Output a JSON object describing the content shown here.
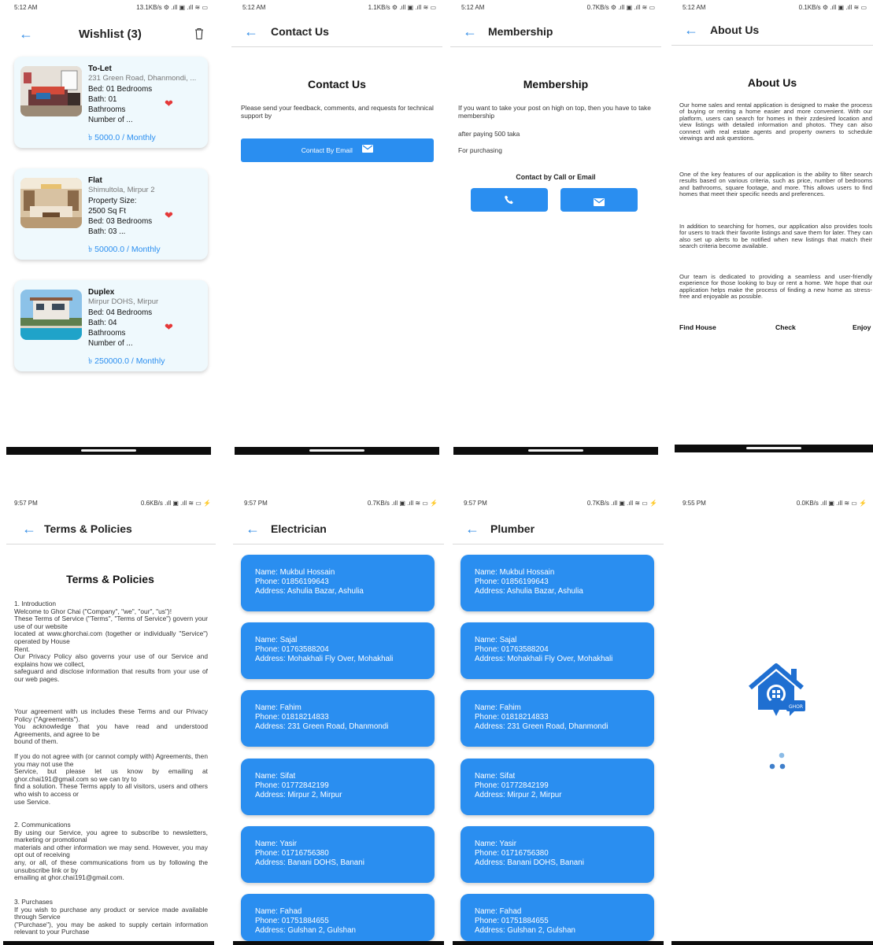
{
  "status_top": {
    "wishlist": {
      "time": "5:12 AM",
      "right": "13.1KB/s ⚙ .ıll ▣ .ıll ≋ ▭"
    },
    "contact": {
      "time": "5:12 AM",
      "right": "1.1KB/s ⚙ .ıll ▣ .ıll ≋ ▭"
    },
    "membership": {
      "time": "5:12 AM",
      "right": "0.7KB/s ⚙ .ıll ▣ .ıll ≋ ▭"
    },
    "about": {
      "time": "5:12 AM",
      "right": "0.1KB/s ⚙ .ıll ▣ .ıll ≋ ▭"
    }
  },
  "status_bottom": {
    "terms": {
      "time": "9:57 PM",
      "right": "0.6KB/s .ıll ▣ .ıll ≋ ▭ ⚡"
    },
    "electrician": {
      "time": "9:57 PM",
      "right": "0.7KB/s .ıll ▣ .ıll ≋ ▭ ⚡"
    },
    "plumber": {
      "time": "9:57 PM",
      "right": "0.7KB/s .ıll ▣ .ıll ≋ ▭ ⚡"
    },
    "splash": {
      "time": "9:55 PM",
      "right": "0.0KB/s .ıll ▣ .ıll ≋ ▭ ⚡"
    }
  },
  "icons": {
    "back": "arrow-left-icon",
    "trash": "trash-icon",
    "heart": "heart-icon",
    "mail": "mail-icon",
    "phone": "phone-icon"
  },
  "colors": {
    "accent": "#2a8ef0",
    "card_bg": "#eff9fd",
    "heart": "#e53939"
  },
  "wishlist": {
    "title": "Wishlist (3)",
    "items": [
      {
        "type": "To-Let",
        "address": "231 Green Road, Dhanmondi, ...",
        "details": "Bed: 01 Bedrooms\nBath: 01\nBathrooms\nNumber of ...",
        "price": "৳ 5000.0 / Monthly"
      },
      {
        "type": "Flat",
        "address": "Shimultola, Mirpur 2",
        "details": "Property Size:\n2500 Sq Ft\nBed: 03 Bedrooms\nBath: 03 ...",
        "price": "৳ 50000.0 / Monthly"
      },
      {
        "type": "Duplex",
        "address": "Mirpur DOHS, Mirpur",
        "details": "Bed: 04 Bedrooms\nBath: 04\nBathrooms\nNumber of ...",
        "price": "৳ 250000.0 / Monthly"
      }
    ]
  },
  "contact": {
    "appbar_title": "Contact Us",
    "heading": "Contact Us",
    "text": "Please send your feedback, comments, and requests for technical support by",
    "button": "Contact By Email"
  },
  "membership": {
    "appbar_title": "Membership",
    "heading": "Membership",
    "line1": "If you want to take your post on high on top, then you have to take membership",
    "line2": "after paying 500 taka",
    "line3": "For purchasing",
    "contact_label": "Contact by Call or Email"
  },
  "about": {
    "appbar_title": "About Us",
    "heading": "About Us",
    "p1": "Our home sales and rental application is designed to make the process of buying or renting a home easier and more convenient. With our platform, users can search for homes in their zzdesired location and view listings with detailed information and photos. They can also connect with real estate agents and property owners to schedule viewings and ask questions.",
    "p2": "One of the key features of our application is the ability to filter search results based on various criteria, such as price, number of bedrooms and bathrooms, square footage, and more. This allows users to find homes that meet their specific needs and preferences.",
    "p3": "In addition to searching for homes, our application also provides tools for users to track their favorite listings and save them for later. They can also set up alerts to be notified when new listings that match their search criteria become available.",
    "p4": "Our team is dedicated to providing a seamless and user-friendly experience for those looking to buy or rent a home. We hope that our application helps make the process of finding a new home as stress-free and enjoyable as possible.",
    "footer": [
      "Find House",
      "Check",
      "Enjoy"
    ]
  },
  "terms": {
    "appbar_title": "Terms & Policies",
    "heading": "Terms & Policies",
    "s1": "1. Introduction\nWelcome to Ghor Chai (\"Company\", \"we\", \"our\", \"us\")!\nThese Terms of Service (\"Terms\", \"Terms of Service\") govern your use of our website\nlocated at www.ghorchai.com (together or individually \"Service\") operated by House\nRent.\nOur Privacy Policy also governs your use of our Service and explains how we collect,\nsafeguard and disclose information that results from your use of our web pages.",
    "s2": "Your agreement with us includes these Terms and our Privacy Policy (\"Agreements\").\nYou acknowledge that you have read and understood Agreements, and agree to be\nbound of them.",
    "s3": "If you do not agree with (or cannot comply with) Agreements, then you may not use the\nService, but please let us know by emailing at ghor.chai191@gmail.com so we can try to\nfind a solution. These Terms apply to all visitors, users and others who wish to access or\nuse Service.",
    "s4": "2. Communications\nBy using our Service, you agree to subscribe to newsletters, marketing or promotional\nmaterials and other information we may send. However, you may opt out of receiving\nany, or all, of these communications from us by following the unsubscribe link or by\nemailing at ghor.chai191@gmail.com.",
    "s5": "3. Purchases\nIf you wish to purchase any product or service made available through Service\n(\"Purchase\"), you may be asked to supply certain information relevant to your Purchase"
  },
  "electrician": {
    "appbar_title": "Electrician",
    "items": [
      {
        "name": "Name: Mukbul Hossain",
        "phone": "Phone: 01856199643",
        "address": "Address: Ashulia Bazar, Ashulia"
      },
      {
        "name": "Name: Sajal",
        "phone": "Phone: 01763588204",
        "address": "Address: Mohakhali Fly Over, Mohakhali"
      },
      {
        "name": "Name: Fahim",
        "phone": "Phone: 01818214833",
        "address": "Address: 231 Green Road, Dhanmondi"
      },
      {
        "name": "Name: Sifat",
        "phone": "Phone: 01772842199",
        "address": "Address: Mirpur 2, Mirpur"
      },
      {
        "name": "Name: Yasir",
        "phone": "Phone: 01716756380",
        "address": "Address: Banani DOHS, Banani"
      },
      {
        "name": "Name: Fahad",
        "phone": "Phone: 01751884655",
        "address": "Address: Gulshan 2, Gulshan"
      }
    ]
  },
  "plumber": {
    "appbar_title": "Plumber",
    "items": [
      {
        "name": "Name: Mukbul Hossain",
        "phone": "Phone: 01856199643",
        "address": "Address: Ashulia Bazar, Ashulia"
      },
      {
        "name": "Name: Sajal",
        "phone": "Phone: 01763588204",
        "address": "Address: Mohakhali Fly Over, Mohakhali"
      },
      {
        "name": "Name: Fahim",
        "phone": "Phone: 01818214833",
        "address": "Address: 231 Green Road, Dhanmondi"
      },
      {
        "name": "Name: Sifat",
        "phone": "Phone: 01772842199",
        "address": "Address: Mirpur 2, Mirpur"
      },
      {
        "name": "Name: Yasir",
        "phone": "Phone: 01716756380",
        "address": "Address: Banani DOHS, Banani"
      },
      {
        "name": "Name: Fahad",
        "phone": "Phone: 01751884655",
        "address": "Address: Gulshan 2, Gulshan"
      }
    ]
  },
  "splash": {
    "logo_badge": "GHOR"
  }
}
